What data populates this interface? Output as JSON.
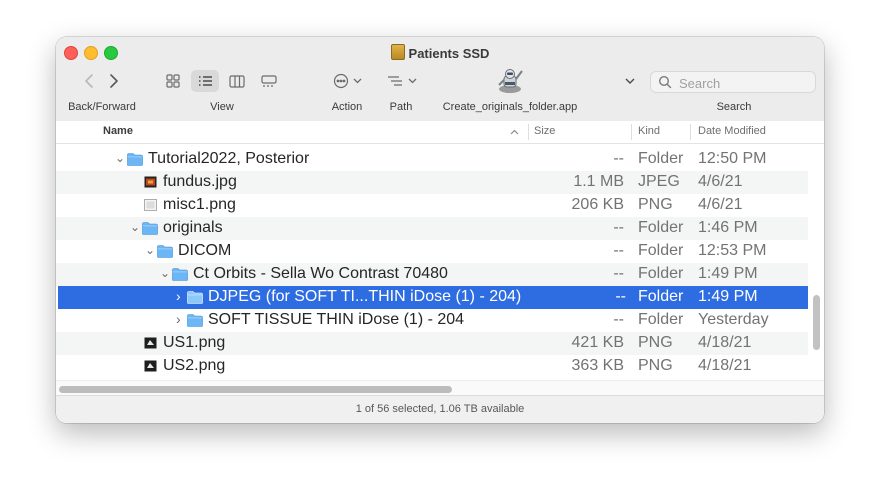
{
  "window": {
    "title": "Patients SSD"
  },
  "toolbar": {
    "back_forward_label": "Back/Forward",
    "view_label": "View",
    "action_label": "Action",
    "path_label": "Path",
    "app_label": "Create_originals_folder.app",
    "search_label": "Search",
    "search_placeholder": "Search"
  },
  "columns": {
    "name": "Name",
    "size": "Size",
    "kind": "Kind",
    "date": "Date Modified"
  },
  "rows": [
    {
      "disclosure": "expanded",
      "icon": "folder-icon",
      "name": "Tutorial2022, Posterior",
      "size": "--",
      "kind": "Folder",
      "date": "12:50 PM"
    },
    {
      "disclosure": "none",
      "icon": "jpeg-icon",
      "name": "fundus.jpg",
      "size": "1.1 MB",
      "kind": "JPEG",
      "date": "4/6/21"
    },
    {
      "disclosure": "none",
      "icon": "png-icon",
      "name": "misc1.png",
      "size": "206 KB",
      "kind": "PNG",
      "date": "4/6/21"
    },
    {
      "disclosure": "expanded",
      "icon": "folder-icon",
      "name": "originals",
      "size": "--",
      "kind": "Folder",
      "date": "1:46 PM"
    },
    {
      "disclosure": "expanded",
      "icon": "folder-icon",
      "name": "DICOM",
      "size": "--",
      "kind": "Folder",
      "date": "12:53 PM"
    },
    {
      "disclosure": "expanded",
      "icon": "folder-icon",
      "name": "Ct Orbits - Sella Wo Contrast 70480",
      "size": "--",
      "kind": "Folder",
      "date": "1:49 PM"
    },
    {
      "disclosure": "collapsed",
      "icon": "folder-icon",
      "name": "DJPEG (for SOFT TI...THIN iDose (1) - 204)",
      "size": "--",
      "kind": "Folder",
      "date": "1:49 PM",
      "selected": true
    },
    {
      "disclosure": "collapsed",
      "icon": "folder-icon",
      "name": "SOFT TISSUE THIN iDose (1) - 204",
      "size": "--",
      "kind": "Folder",
      "date": "Yesterday"
    },
    {
      "disclosure": "none",
      "icon": "png-icon",
      "name": "US1.png",
      "size": "421 KB",
      "kind": "PNG",
      "date": "4/18/21"
    },
    {
      "disclosure": "none",
      "icon": "png-icon",
      "name": "US2.png",
      "size": "363 KB",
      "kind": "PNG",
      "date": "4/18/21"
    }
  ],
  "status": {
    "text": "1 of 56 selected, 1.06 TB available"
  },
  "colors": {
    "selection": "#2e6ce1",
    "folder": "#6cb6f5"
  }
}
